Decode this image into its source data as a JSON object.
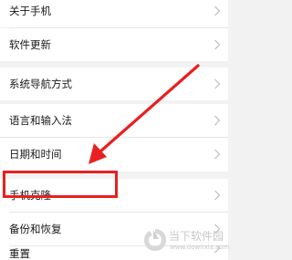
{
  "settings": {
    "items": [
      {
        "label": "关于手机",
        "chevron": "chevron-right-icon"
      },
      {
        "label": "软件更新",
        "chevron": "chevron-right-icon"
      },
      {
        "label": "系统导航方式",
        "chevron": "chevron-right-icon"
      },
      {
        "label": "语言和输入法",
        "chevron": "chevron-right-icon"
      },
      {
        "label": "日期和时间",
        "chevron": "chevron-right-icon"
      },
      {
        "label": "手机克隆",
        "chevron": "chevron-right-icon"
      },
      {
        "label": "备份和恢复",
        "chevron": "chevron-right-icon",
        "highlighted": true
      },
      {
        "label": "重置",
        "chevron": "chevron-right-icon"
      }
    ]
  },
  "annotation": {
    "highlight_color": "#e8201f",
    "arrow_color": "#e8201f"
  },
  "watermark": {
    "title": "当下软件园",
    "url": "www.downxia.com",
    "icon": "downxia-logo"
  },
  "colors": {
    "background": "#f2f2f2",
    "row": "#ffffff",
    "text": "#1a1a1a",
    "chevron": "#c4c4c4"
  }
}
